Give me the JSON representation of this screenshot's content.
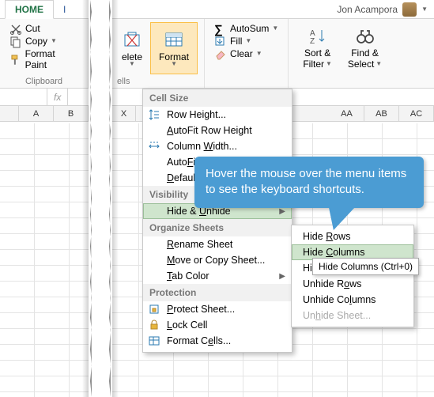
{
  "user_name": "Jon Acampora",
  "tabs": {
    "home": "HOME",
    "second": "I"
  },
  "clipboard": {
    "cut": "Cut",
    "copy": "Copy",
    "paint": "Format Paint",
    "label": "Clipboard"
  },
  "cells": {
    "delete": "lete",
    "delete_suffix": "elete",
    "format": "Format",
    "label": "ells"
  },
  "editing": {
    "autosum": "AutoSum",
    "fill": "Fill",
    "clear": "Clear",
    "sort": "Sort &",
    "filter": "Filter",
    "find": "Find &",
    "select": "Select"
  },
  "cols_left": [
    "A",
    "B"
  ],
  "cols_right": [
    "X",
    "AA",
    "AB",
    "AC"
  ],
  "menu": {
    "cell_size": "Cell Size",
    "row_height": "Row Height...",
    "autofit_row": "AutoFit Row Height",
    "col_width": "Column Width...",
    "autofit_col": "AutoFit Column Width",
    "default_w": "Default Width...",
    "visibility": "Visibility",
    "hide_unhide": "Hide & Unhide",
    "organize": "Organize Sheets",
    "rename": "Rename Sheet",
    "move_copy": "Move or Copy Sheet...",
    "tab_color": "Tab Color",
    "protection": "Protection",
    "protect_sheet": "Protect Sheet...",
    "lock_cell": "Lock Cell",
    "format_cells": "Format Cells..."
  },
  "submenu": {
    "hide_rows": "Hide Rows",
    "hide_cols": "Hide Columns",
    "hide_sheet": "Hide Sheet",
    "unhide_rows": "Unhide Rows",
    "unhide_cols": "Unhide Columns",
    "unhide_sheet": "Unhide Sheet..."
  },
  "tooltip": "Hide Columns (Ctrl+0)",
  "callout": "Hover the mouse over the menu items to see the keyboard shortcuts."
}
